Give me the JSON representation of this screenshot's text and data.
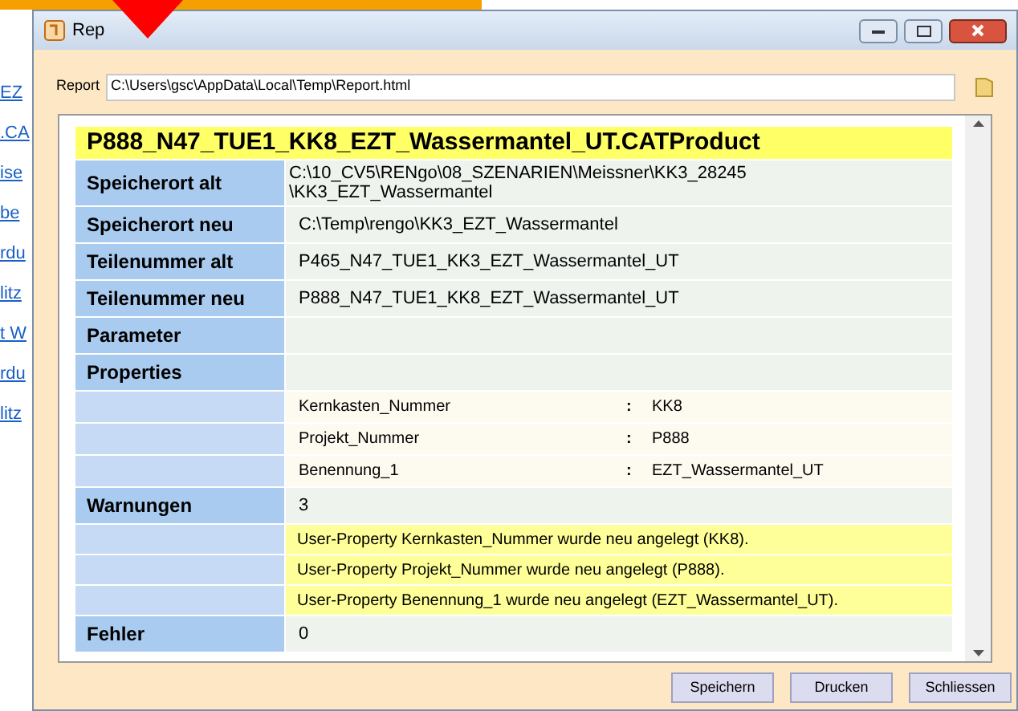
{
  "background_links": [
    "EZ",
    ".CA",
    "ise",
    "be",
    "rdu",
    "litz",
    "t W",
    "rdu",
    "litz"
  ],
  "window": {
    "title": "Rep"
  },
  "report_field": {
    "label": "Report",
    "value": "C:\\Users\\gsc\\AppData\\Local\\Temp\\Report.html"
  },
  "report": {
    "heading": "P888_N47_TUE1_KK8_EZT_Wassermantel_UT.CATProduct",
    "rows": [
      {
        "kind": "field",
        "label": "Speicherort alt",
        "value": "C:\\10_CV5\\RENgo\\08_SZENARIEN\\Meissner\\KK3_28245\n\\KK3_EZT_Wassermantel"
      },
      {
        "kind": "field",
        "label": "Speicherort neu",
        "value": "C:\\Temp\\rengo\\KK3_EZT_Wassermantel"
      },
      {
        "kind": "field",
        "label": "Teilenummer alt",
        "value": "P465_N47_TUE1_KK3_EZT_Wassermantel_UT"
      },
      {
        "kind": "field",
        "label": "Teilenummer neu",
        "value": "P888_N47_TUE1_KK8_EZT_Wassermantel_UT"
      },
      {
        "kind": "field",
        "label": "Parameter",
        "value": ""
      },
      {
        "kind": "field",
        "label": "Properties",
        "value": ""
      },
      {
        "kind": "property",
        "name": "Kernkasten_Nummer",
        "separator": ":",
        "value": "KK8"
      },
      {
        "kind": "property",
        "name": "Projekt_Nummer",
        "separator": ":",
        "value": "P888"
      },
      {
        "kind": "property",
        "name": "Benennung_1",
        "separator": ":",
        "value": "EZT_Wassermantel_UT"
      },
      {
        "kind": "field",
        "label": "Warnungen",
        "value": "3"
      },
      {
        "kind": "warning",
        "text": "User-Property Kernkasten_Nummer wurde neu angelegt (KK8)."
      },
      {
        "kind": "warning",
        "text": "User-Property Projekt_Nummer wurde neu angelegt (P888)."
      },
      {
        "kind": "warning",
        "text": "User-Property Benennung_1 wurde neu angelegt (EZT_Wassermantel_UT)."
      },
      {
        "kind": "field",
        "label": "Fehler",
        "value": "0"
      }
    ]
  },
  "buttons": [
    "Speichern",
    "Drucken",
    "Schliessen"
  ]
}
